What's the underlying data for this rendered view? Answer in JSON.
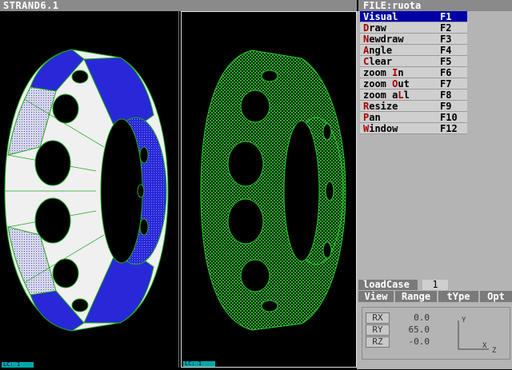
{
  "app": {
    "title": "STRAND6.1"
  },
  "file": {
    "label": "FILE:ruota"
  },
  "menu": [
    {
      "hot": "V",
      "rest": "isual",
      "key": "F1",
      "selected": true
    },
    {
      "hot": "D",
      "rest": "raw",
      "key": "F2"
    },
    {
      "hot": "N",
      "rest": "ewdraw",
      "key": "F3"
    },
    {
      "hot": "A",
      "rest": "ngle",
      "key": "F4"
    },
    {
      "hot": "C",
      "rest": "lear",
      "key": "F5"
    },
    {
      "pre": "zoom ",
      "hot": "I",
      "rest": "n",
      "key": "F6"
    },
    {
      "pre": "zoom ",
      "hot": "O",
      "rest": "ut",
      "key": "F7"
    },
    {
      "pre": "zoom a",
      "hot": "L",
      "rest": "l",
      "key": "F8"
    },
    {
      "hot": "R",
      "rest": "esize",
      "key": "F9"
    },
    {
      "hot": "P",
      "rest": "an",
      "key": "F10"
    },
    {
      "hot": "W",
      "rest": "indow",
      "key": "F12"
    }
  ],
  "loadcase": {
    "label": "loadCase",
    "value": "1"
  },
  "tabs": [
    "View",
    "Range",
    "tYpe",
    "Opt"
  ],
  "rotation": [
    {
      "label": "RX",
      "value": "0.0"
    },
    {
      "label": "RY",
      "value": "65.0"
    },
    {
      "label": "RZ",
      "value": "-0.0"
    }
  ],
  "axes": {
    "y": "Y",
    "x": "X",
    "z": "Z"
  },
  "viewports": [
    {
      "label": "LC: 1"
    },
    {
      "label": "LC: 1"
    }
  ],
  "colors": {
    "menu_selected": "#0000a8",
    "hotkey": "#a80000",
    "mesh_green": "#2ec82e",
    "shade_blue": "#2828d8"
  }
}
